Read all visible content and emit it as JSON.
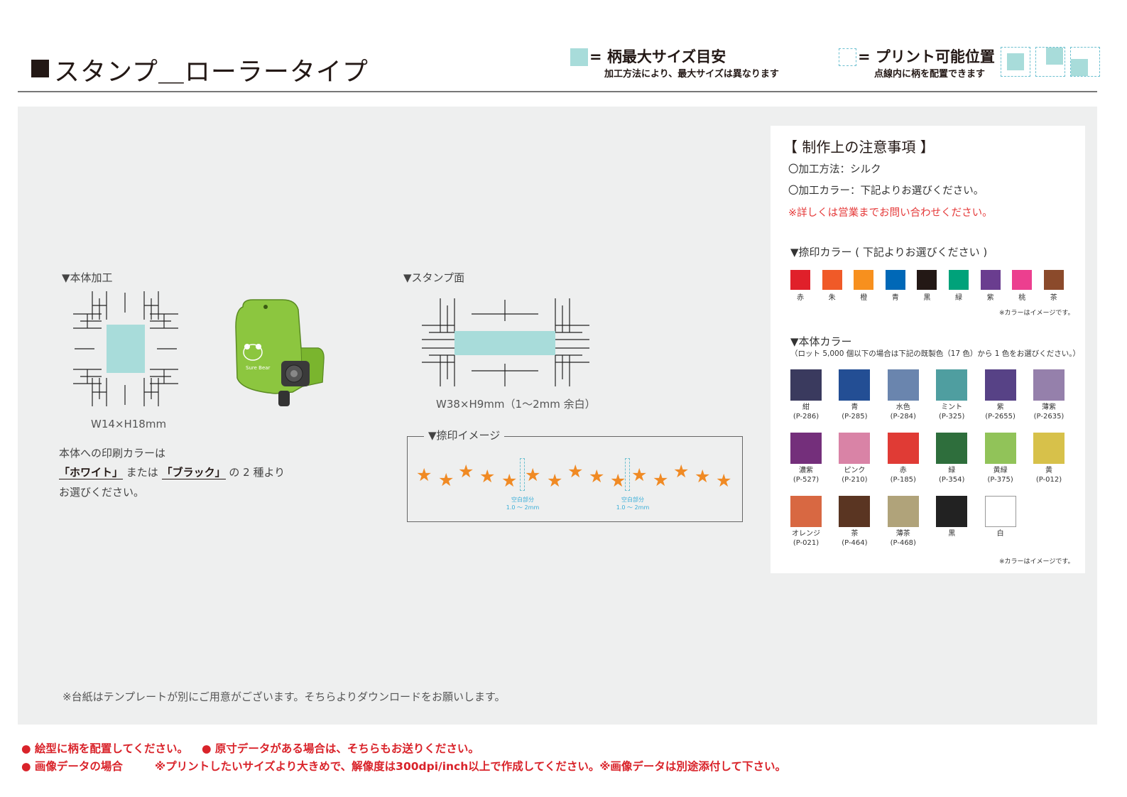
{
  "header": {
    "title": "スタンプ＿ローラータイプ",
    "legend_max_size": "= 柄最大サイズ目安",
    "legend_max_size_note": "加工方法により、最大サイズは異なります",
    "legend_print_area": "= プリント可能位置",
    "legend_print_area_note": "点線内に柄を配置できます",
    "color_max_size": "#a8dcda",
    "color_print_area": "#6cc0d0"
  },
  "body_processing": {
    "label": "▼本体加工",
    "dimension": "W14×H18mm",
    "note_line1": "本体への印刷カラーは",
    "note_white": "「ホワイト」",
    "note_or": "または",
    "note_black": "「ブラック」",
    "note_suffix": "の 2 種より",
    "note_line3": "お選びください。"
  },
  "stamp_face": {
    "label": "▼スタンプ面",
    "dimension": "W38×H9mm（1～2mm 余白）"
  },
  "imprint_image": {
    "label": "▼捺印イメージ",
    "gap_label_1": "空白部分",
    "gap_label_2": "1.0 ～ 2mm",
    "star_color": "#f08a24"
  },
  "bottom_note": "※台紙はテンプレートが別にご用意がございます。そちらよりダウンロードをお願いします。",
  "notes": {
    "title": "【 制作上の注意事項 】",
    "method": "〇加工方法：シルク",
    "color": "〇加工カラー：下記よりお選びください。",
    "warning": "※詳しくは営業までお問い合わせください。",
    "ink_heading": "▼捺印カラー ( 下記よりお選びください )",
    "ink_colors": [
      {
        "name": "赤",
        "hex": "#e0202a"
      },
      {
        "name": "朱",
        "hex": "#f05a28"
      },
      {
        "name": "橙",
        "hex": "#f7901e"
      },
      {
        "name": "青",
        "hex": "#0068b7"
      },
      {
        "name": "黒",
        "hex": "#231815"
      },
      {
        "name": "緑",
        "hex": "#00a27a"
      },
      {
        "name": "紫",
        "hex": "#6a3d8f"
      },
      {
        "name": "桃",
        "hex": "#ec3f8f"
      },
      {
        "name": "茶",
        "hex": "#8b4a2b"
      }
    ],
    "image_note": "※カラーはイメージです。",
    "body_heading": "▼本体カラー",
    "body_subheading": "（ロット 5,000 個以下の場合は下記の既製色（17 色）から 1 色をお選びください。）",
    "body_colors": [
      {
        "name": "紺",
        "code": "(P-286)",
        "hex": "#3a3a5e"
      },
      {
        "name": "青",
        "code": "(P-285)",
        "hex": "#234e94"
      },
      {
        "name": "水色",
        "code": "(P-284)",
        "hex": "#6a85ae"
      },
      {
        "name": "ミント",
        "code": "(P-325)",
        "hex": "#4f9ea0"
      },
      {
        "name": "紫",
        "code": "(P-2655)",
        "hex": "#574286"
      },
      {
        "name": "薄紫",
        "code": "(P-2635)",
        "hex": "#9580ab"
      },
      {
        "name": "濃紫",
        "code": "(P-527)",
        "hex": "#742f7b"
      },
      {
        "name": "ピンク",
        "code": "(P-210)",
        "hex": "#d983a6"
      },
      {
        "name": "赤",
        "code": "(P-185)",
        "hex": "#e03b35"
      },
      {
        "name": "緑",
        "code": "(P-354)",
        "hex": "#2e6e3c"
      },
      {
        "name": "黄緑",
        "code": "(P-375)",
        "hex": "#91c359"
      },
      {
        "name": "黄",
        "code": "(P-012)",
        "hex": "#d7c14a"
      },
      {
        "name": "オレンジ",
        "code": "(P-021)",
        "hex": "#d86842"
      },
      {
        "name": "茶",
        "code": "(P-464)",
        "hex": "#5a3522"
      },
      {
        "name": "薄茶",
        "code": "(P-468)",
        "hex": "#b0a37a"
      },
      {
        "name": "黒",
        "code": "",
        "hex": "#222222"
      },
      {
        "name": "白",
        "code": "",
        "hex": "#ffffff"
      }
    ]
  },
  "footer": {
    "item1": "● 絵型に柄を配置してください。",
    "item2": "● 原寸データがある場合は、そちらもお送りください。",
    "item3": "● 画像データの場合",
    "item3_detail": "※プリントしたいサイズより大きめで、解像度は300dpi/inch以上で作成してください。※画像データは別途添付して下さい。"
  }
}
